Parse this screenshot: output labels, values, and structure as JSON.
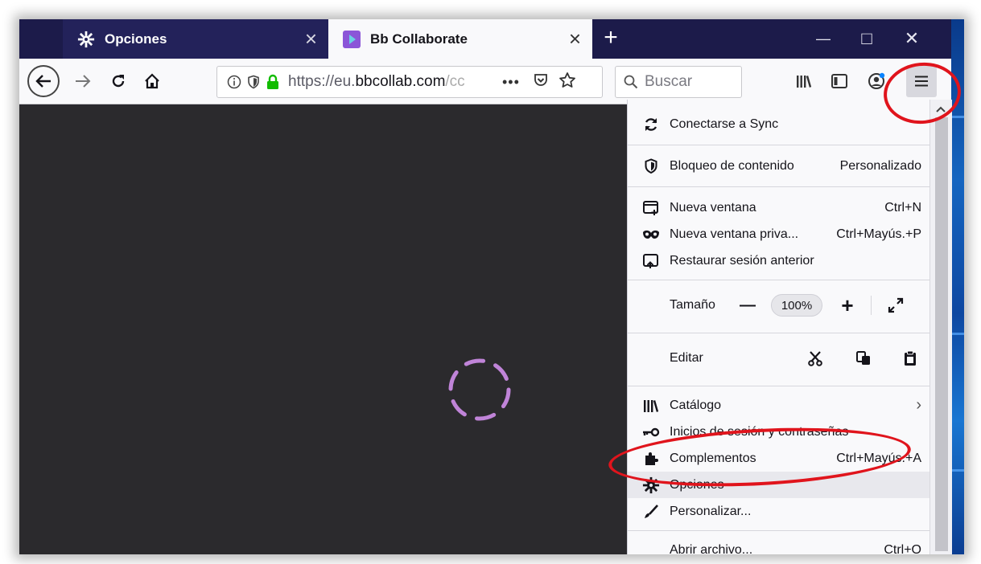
{
  "tabs": [
    {
      "label": "Opciones",
      "icon": "gear-icon"
    },
    {
      "label": "Bb Collaborate",
      "icon": "bb-collaborate-icon"
    }
  ],
  "tab_close_glyph": "×",
  "new_tab_glyph": "+",
  "window_controls": {
    "minimize": "—",
    "maximize": "□",
    "close": "✕"
  },
  "navbar": {
    "url_prefix": "https://eu.",
    "url_domain": "bbcollab.com",
    "url_suffix": "/cc",
    "page_actions": "•••",
    "search_placeholder": "Buscar"
  },
  "menu": {
    "sync": "Conectarse a Sync",
    "content_blocking": "Bloqueo de contenido",
    "content_blocking_value": "Personalizado",
    "new_window": "Nueva ventana",
    "new_window_sc": "Ctrl+N",
    "private_window": "Nueva ventana priva...",
    "private_window_sc": "Ctrl+Mayús.+P",
    "restore_session": "Restaurar sesión anterior",
    "zoom_label": "Tamaño",
    "zoom_minus": "—",
    "zoom_value": "100%",
    "zoom_plus": "+",
    "edit_label": "Editar",
    "library": "Catálogo",
    "library_arrow": "›",
    "logins": "Inicios de sesión y contraseñas",
    "addons": "Complementos",
    "addons_sc": "Ctrl+Mayús.+A",
    "options": "Opciones",
    "customize": "Personalizar...",
    "open_file": "Abrir archivo...",
    "open_file_sc": "Ctrl+O"
  },
  "colors": {
    "annotation": "#e0141c",
    "spinner": "#c084d8",
    "tabstrip": "#1c1b4a",
    "content_bg": "#2b2a2d"
  }
}
